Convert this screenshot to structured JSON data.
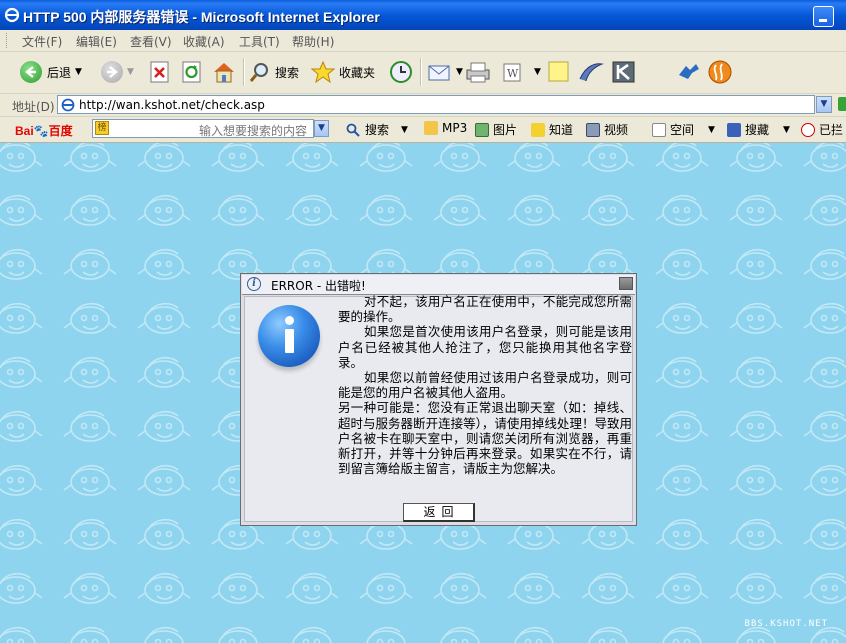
{
  "window": {
    "title": "HTTP 500 内部服务器错误 - Microsoft Internet Explorer"
  },
  "menu": [
    "文件(F)",
    "编辑(E)",
    "查看(V)",
    "收藏(A)",
    "工具(T)",
    "帮助(H)"
  ],
  "toolbar": {
    "back_label": "后退",
    "search_label": "搜索",
    "favorites_label": "收藏夹"
  },
  "address": {
    "label": "地址(D)",
    "url": "http://wan.kshot.net/check.asp"
  },
  "baidu_bar": {
    "logo_part1": "Bai",
    "logo_part2": "百度",
    "input_placeholder": "输入想要搜索的内容",
    "search_label": "搜索",
    "mp3_label": "MP3",
    "images_label": "图片",
    "zhidao_label": "知道",
    "video_label": "视频",
    "space_label": "空间",
    "souzang_label": "搜藏",
    "blocked_label": "已拦"
  },
  "dialog": {
    "title": "ERROR - 出错啦!",
    "paragraphs": [
      "对不起，该用户名正在使用中，不能完成您所需要的操作。",
      "如果您是首次使用该用户名登录，则可能是该用户名已经被其他人抢注了，您只能换用其他名字登录。",
      "如果您以前曾经使用过该用户名登录成功，则可能是您的用户名被其他人盗用。",
      "另一种可能是：您没有正常退出聊天室（如：掉线、超时与服务器断开连接等），请使用掉线处理！导致用户名被卡在聊天室中，则请您关闭所有浏览器，再重新打开，并等十分钟后再来登录。如果实在不行，请到留言簿给版主留言，请版主为您解决。"
    ],
    "back_button": "返回"
  },
  "watermark": "BBS.KSHOT.NET",
  "colors": {
    "content_bg": "#8ED4EE",
    "titlebar": "#0558D8",
    "dialog_bg": "#DCDDE6"
  }
}
